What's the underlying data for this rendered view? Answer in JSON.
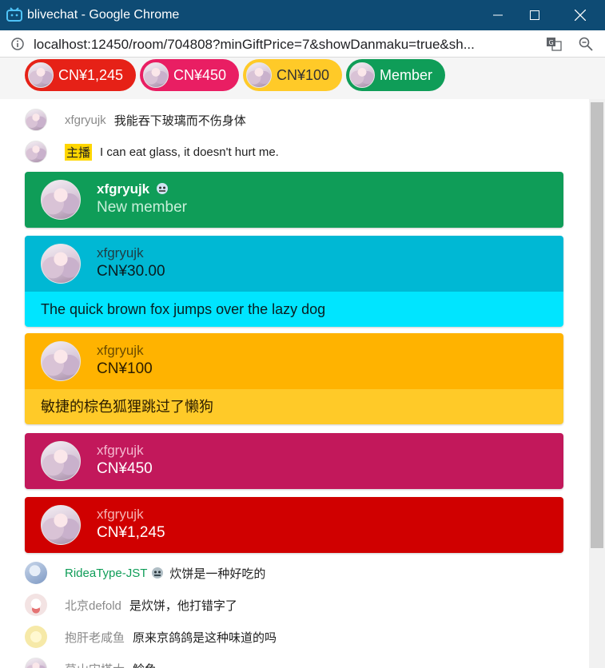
{
  "window": {
    "title": "blivechat - Google Chrome"
  },
  "urlbar": {
    "url": "localhost:12450/room/704808?minGiftPrice=7&showDanmaku=true&sh..."
  },
  "ticker": {
    "items": [
      {
        "label": "CN¥1,245",
        "color": "#e62117"
      },
      {
        "label": "CN¥450",
        "color": "#e91e63"
      },
      {
        "label": "CN¥100",
        "color": "#ffca28"
      },
      {
        "label": "Member",
        "color": "#0f9d58"
      }
    ]
  },
  "messages": [
    {
      "author": "xfgryujk",
      "text": "我能吞下玻璃而不伤身体"
    },
    {
      "badge": "主播",
      "text": "I can eat glass, it doesn't hurt me."
    }
  ],
  "cards": {
    "member": {
      "name": "xfgryujk",
      "sub": "New member",
      "color": "#0f9d58"
    },
    "sc30": {
      "name": "xfgryujk",
      "amount": "CN¥30.00",
      "message": "The quick brown fox jumps over the lazy dog",
      "head_color": "#00b8d4",
      "body_color": "#00e5ff"
    },
    "sc100": {
      "name": "xfgryujk",
      "amount": "CN¥100",
      "message": "敏捷的棕色狐狸跳过了懒狗",
      "head_color": "#ffb300",
      "body_color": "#ffca28"
    },
    "sc450": {
      "name": "xfgryujk",
      "amount": "CN¥450",
      "color": "#c2185b"
    },
    "sc1245": {
      "name": "xfgryujk",
      "amount": "CN¥1,245",
      "color": "#d00000"
    }
  },
  "bottom_messages": [
    {
      "author": "RideaType-JST",
      "text": "炊饼是一种好吃的"
    },
    {
      "author": "北京defold",
      "text": "是炊饼，他打错字了"
    },
    {
      "author": "抱肝老咸鱼",
      "text": "原来京鸽鸽是这种味道的吗"
    },
    {
      "author": "草山宋塔大",
      "text": "鲶鱼"
    }
  ]
}
